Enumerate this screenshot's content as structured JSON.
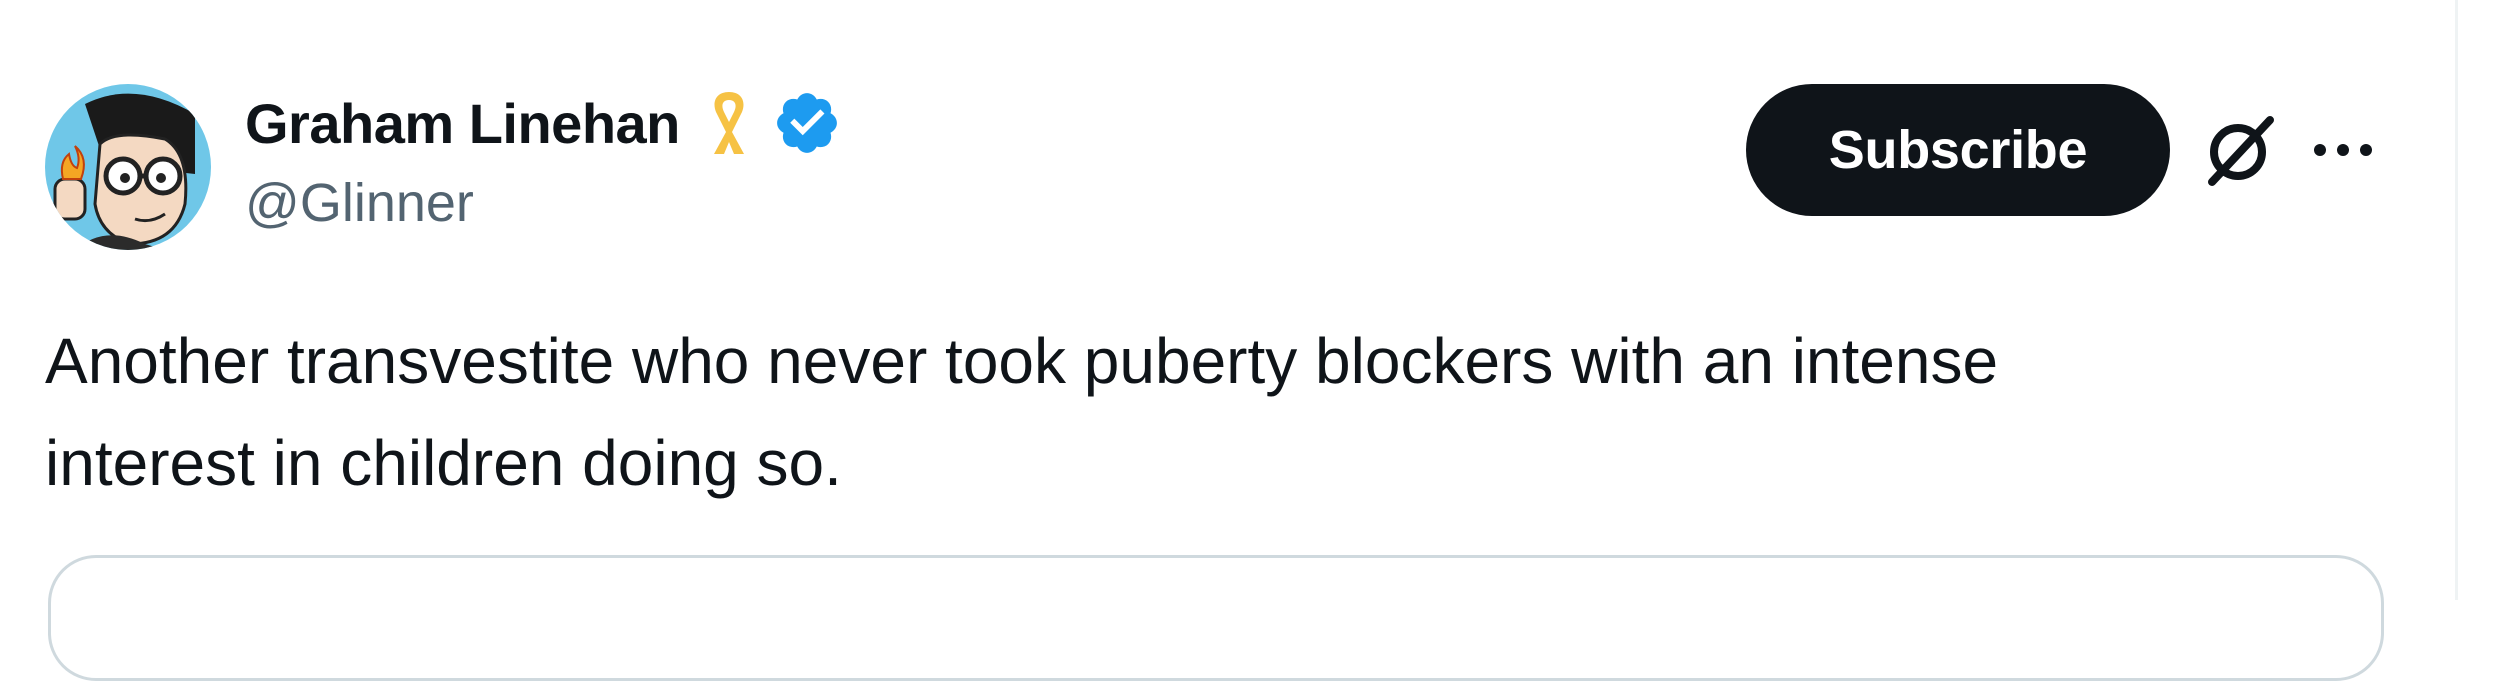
{
  "author": {
    "display_name": "Graham Linehan",
    "handle": "@Glinner",
    "avatar_icon": "cartoon-avatar",
    "badges": [
      "yellow-ribbon-icon",
      "verified-badge-icon"
    ]
  },
  "actions": {
    "subscribe_label": "Subscribe",
    "grok_icon": "grok-icon",
    "more_icon": "more-icon"
  },
  "tweet": {
    "text": "Another transvestite who never took puberty blockers with an intense\ninterest in children doing so."
  },
  "colors": {
    "text_primary": "#0f1419",
    "text_secondary": "#536471",
    "verified_blue": "#1d9bf0",
    "ribbon_yellow": "#f6c244",
    "button_bg": "#0f1419",
    "card_border": "#cfd9de"
  }
}
